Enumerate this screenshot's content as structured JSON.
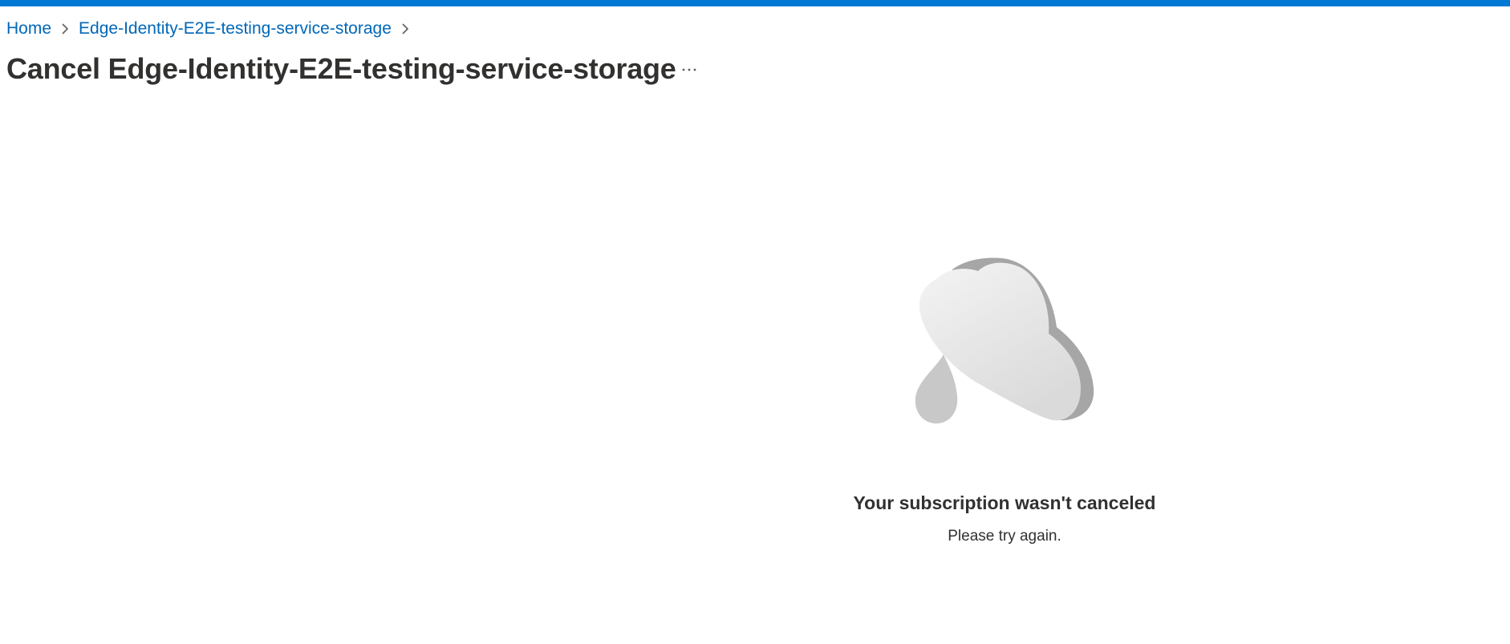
{
  "colors": {
    "accent": "#0078d4",
    "link": "#0067b8",
    "text": "#323130",
    "muted": "#605e5c",
    "cloud_light": "#eeeeee",
    "cloud_side": "#a6a6a6",
    "drop": "#c8c8c8"
  },
  "breadcrumb": {
    "items": [
      {
        "label": "Home"
      },
      {
        "label": "Edge-Identity-E2E-testing-service-storage"
      }
    ],
    "separator_icon": "chevron-right-icon"
  },
  "header": {
    "title": "Cancel Edge-Identity-E2E-testing-service-storage",
    "more_icon": "ellipsis-icon"
  },
  "empty_state": {
    "illustration_icon": "cloud-rain-icon",
    "title": "Your subscription wasn't canceled",
    "subtitle": "Please try again."
  }
}
